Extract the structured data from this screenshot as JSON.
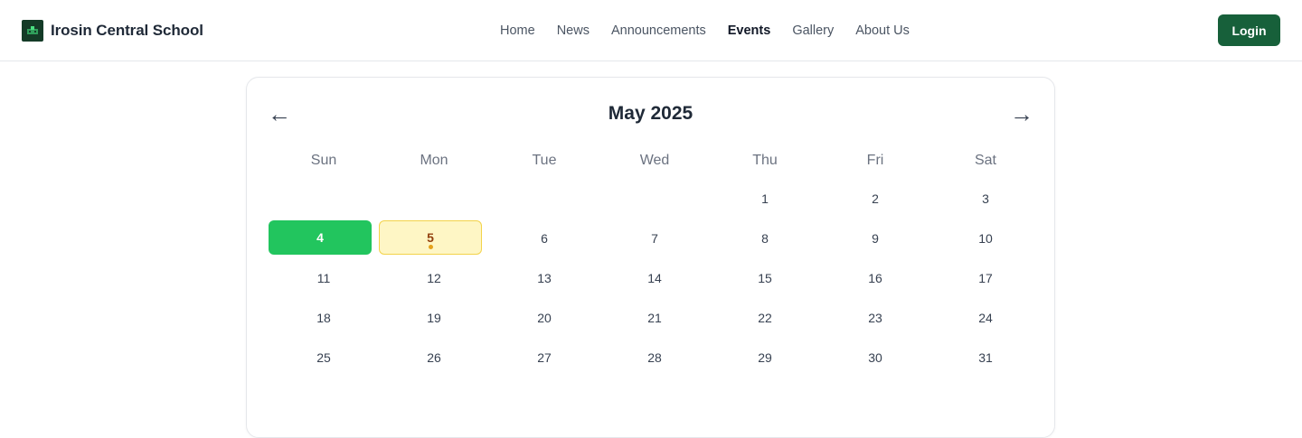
{
  "brand": {
    "name": "Irosin Central School",
    "logo_icon": "school-logo-icon"
  },
  "nav": {
    "items": [
      {
        "label": "Home",
        "active": false
      },
      {
        "label": "News",
        "active": false
      },
      {
        "label": "Announcements",
        "active": false
      },
      {
        "label": "Events",
        "active": true
      },
      {
        "label": "Gallery",
        "active": false
      },
      {
        "label": "About Us",
        "active": false
      }
    ],
    "login_label": "Login"
  },
  "calendar": {
    "month_title": "May 2025",
    "prev_arrow": "←",
    "next_arrow": "→",
    "weekdays": [
      "Sun",
      "Mon",
      "Tue",
      "Wed",
      "Thu",
      "Fri",
      "Sat"
    ],
    "leading_blanks": 4,
    "days": [
      "1",
      "2",
      "3",
      "4",
      "5",
      "6",
      "7",
      "8",
      "9",
      "10",
      "11",
      "12",
      "13",
      "14",
      "15",
      "16",
      "17",
      "18",
      "19",
      "20",
      "21",
      "22",
      "23",
      "24",
      "25",
      "26",
      "27",
      "28",
      "29",
      "30",
      "31"
    ],
    "today": "4",
    "event_days": [
      "5"
    ]
  },
  "colors": {
    "brand_green": "#17603a",
    "today_green": "#22c55e",
    "event_yellow": "#fef6c5",
    "event_border": "#f3d34a",
    "event_dot": "#e5a11b"
  }
}
